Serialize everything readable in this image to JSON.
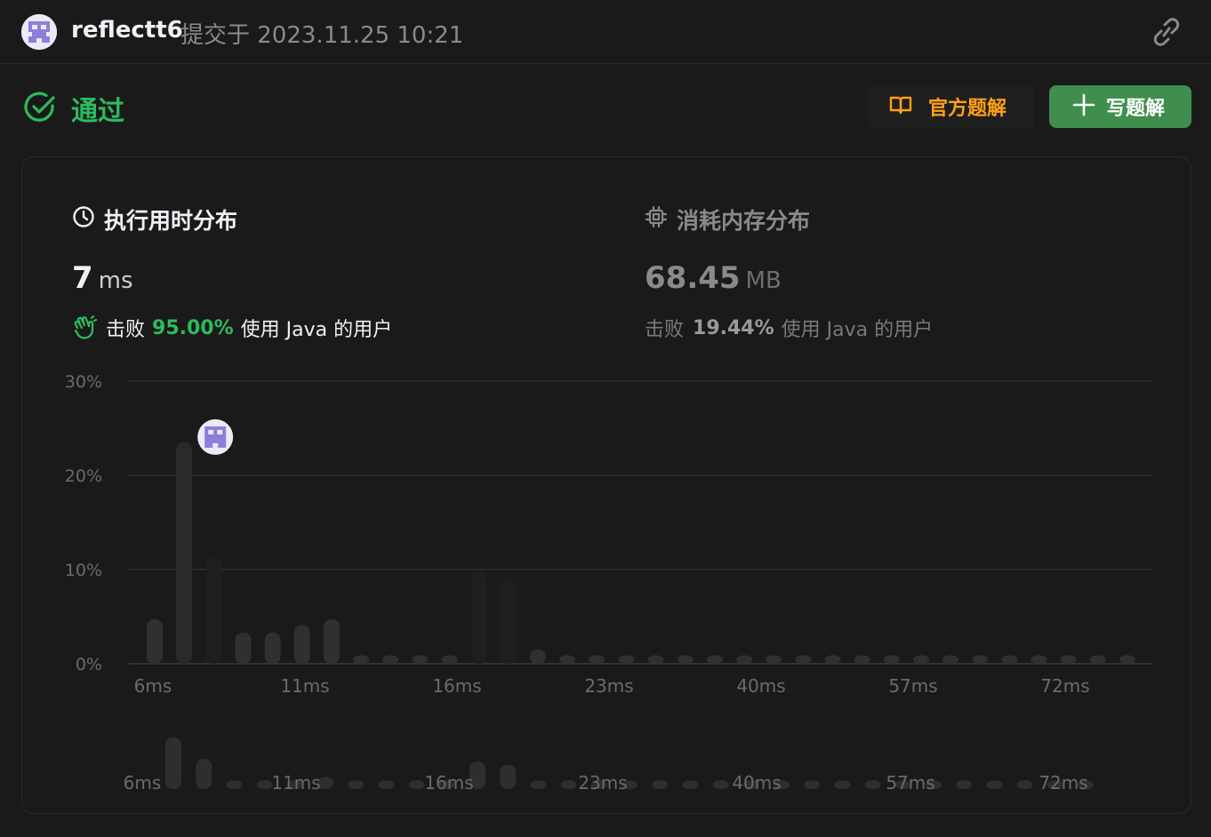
{
  "header": {
    "username": "reflectt6",
    "submitted_text": "提交于 2023.11.25 10:21"
  },
  "status": {
    "label": "通过",
    "official_solution": "官方题解",
    "write_solution": "写题解"
  },
  "runtime": {
    "title": "执行用时分布",
    "value": "7",
    "unit": "ms",
    "beat_prefix": "击败",
    "beat_pct": "95.00%",
    "beat_suffix": "使用 Java 的用户"
  },
  "memory": {
    "title": "消耗内存分布",
    "value": "68.45",
    "unit": "MB",
    "beat_prefix": "击败",
    "beat_pct": "19.44%",
    "beat_suffix": "使用 Java 的用户"
  },
  "colors": {
    "accent_green": "#2cbb5d",
    "official_orange": "#ffa116",
    "write_button": "#3f8e4d",
    "background": "#1a1a1a"
  },
  "chart_data": [
    {
      "type": "bar",
      "title": "",
      "xlabel": "",
      "ylabel": "",
      "ylim": [
        0,
        30
      ],
      "yticks": [
        "0%",
        "10%",
        "20%",
        "30%"
      ],
      "xticks": [
        "6ms",
        "11ms",
        "16ms",
        "23ms",
        "40ms",
        "57ms",
        "72ms"
      ],
      "highlight": {
        "x": "7ms",
        "value": 23.5
      },
      "values": [
        4.7,
        23.5,
        11.2,
        3.3,
        3.3,
        4.1,
        4.7,
        0.9,
        0.9,
        0.9,
        0.9,
        9.8,
        8.9,
        1.5,
        0.9,
        0.9,
        0.9,
        0.9,
        0.9,
        0.9,
        0.9,
        0.9,
        0.9,
        0.9,
        0.9,
        0.9,
        0.9,
        0.9,
        0.9,
        0.9,
        0.9,
        0.9,
        0.9,
        0.9
      ]
    },
    {
      "type": "bar",
      "title": "",
      "xticks": [
        "6ms",
        "11ms",
        "16ms",
        "23ms",
        "40ms",
        "57ms",
        "72ms"
      ],
      "values": [
        6.0,
        3.5,
        1.0,
        1.0,
        1.0,
        1.4,
        1.0,
        1.0,
        1.0,
        1.0,
        3.2,
        2.8,
        1.0,
        1.0,
        1.0,
        1.0,
        1.0,
        1.0,
        1.0,
        1.0,
        1.0,
        1.0,
        1.0,
        1.0,
        1.0,
        1.0,
        1.0,
        1.0,
        1.0,
        1.0,
        1.0
      ]
    }
  ]
}
